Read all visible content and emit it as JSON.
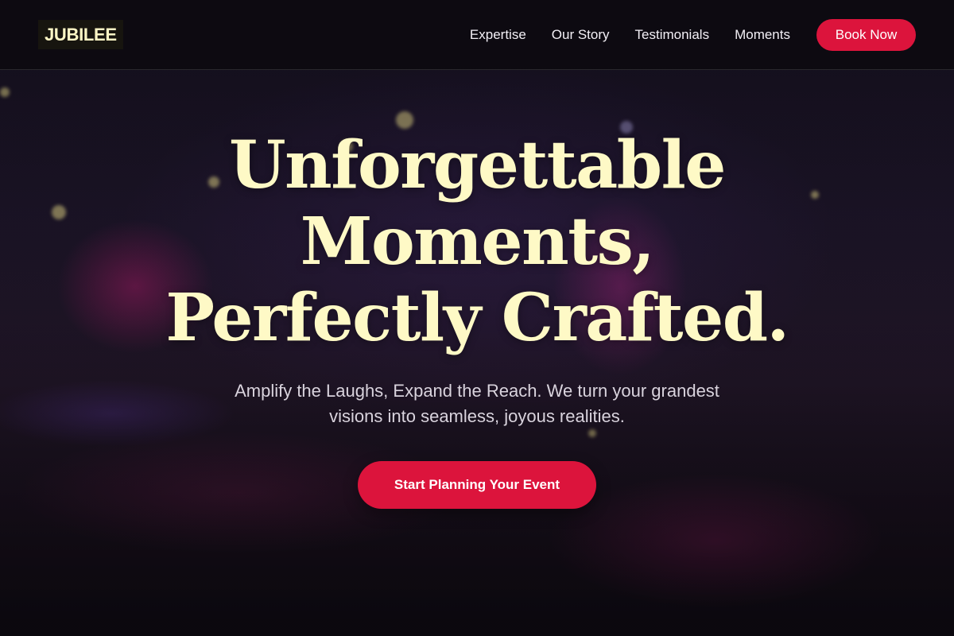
{
  "nav": {
    "brand": "JUBILEE",
    "links": [
      "Expertise",
      "Our Story",
      "Testimonials",
      "Moments"
    ],
    "book_label": "Book Now"
  },
  "hero": {
    "title_lines": [
      "Unforgettable",
      "Moments,",
      "Perfectly Crafted."
    ],
    "subtitle": "Amplify the Laughs, Expand the Reach. We turn your grandest visions into seamless, joyous realities.",
    "cta_label": "Start Planning Your Event"
  },
  "colors": {
    "accent": "#dc143c",
    "title": "#fef9c6",
    "nav_bg": "#0c0a10"
  }
}
